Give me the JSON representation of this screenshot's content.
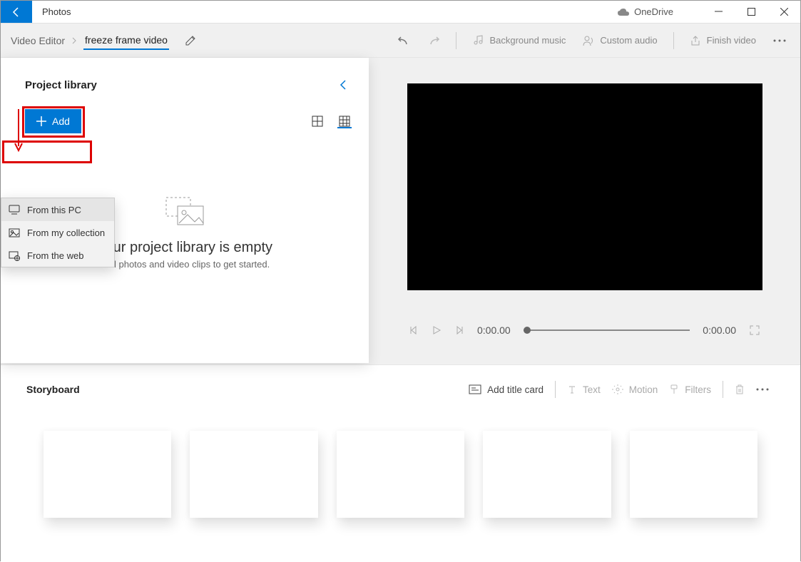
{
  "titlebar": {
    "app_name": "Photos",
    "onedrive": "OneDrive"
  },
  "breadcrumb": {
    "root": "Video Editor",
    "project": "freeze frame video"
  },
  "toolbar": {
    "bg_music": "Background music",
    "custom_audio": "Custom audio",
    "finish": "Finish video"
  },
  "library": {
    "title": "Project library",
    "add": "Add",
    "empty_heading": "Your project library is empty",
    "empty_sub": "Add photos and video clips to get started."
  },
  "dropdown": {
    "from_pc": "From this PC",
    "from_collection": "From my collection",
    "from_web": "From the web"
  },
  "player": {
    "current": "0:00.00",
    "total": "0:00.00"
  },
  "storyboard": {
    "title": "Storyboard",
    "add_title": "Add title card",
    "text": "Text",
    "motion": "Motion",
    "filters": "Filters"
  }
}
